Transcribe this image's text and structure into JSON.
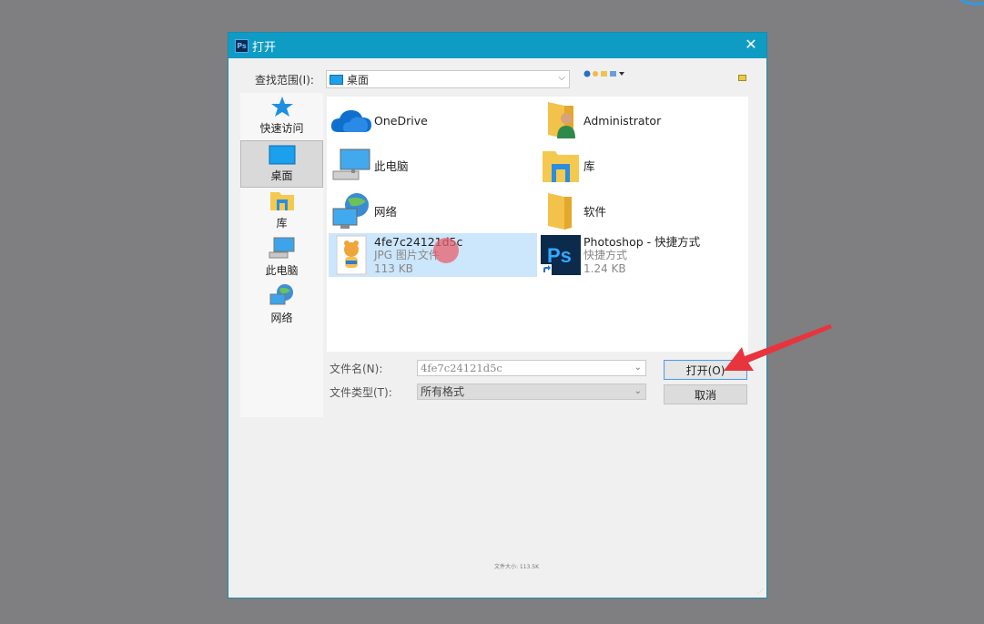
{
  "dialog": {
    "title": "打开",
    "app_icon_text": "Ps",
    "close_glyph": "✕"
  },
  "lookin": {
    "label": "查找范围(I):",
    "value": "桌面"
  },
  "places": [
    {
      "label": "快速访问",
      "icon": "star-icon"
    },
    {
      "label": "桌面",
      "icon": "desktop-icon",
      "selected": true
    },
    {
      "label": "库",
      "icon": "library-icon"
    },
    {
      "label": "此电脑",
      "icon": "computer-icon"
    },
    {
      "label": "网络",
      "icon": "network-icon"
    }
  ],
  "files": [
    {
      "name": "OneDrive",
      "icon": "cloud-icon"
    },
    {
      "name": "Administrator",
      "icon": "user-folder-icon"
    },
    {
      "name": "此电脑",
      "icon": "computer-icon"
    },
    {
      "name": "库",
      "icon": "library-icon"
    },
    {
      "name": "网络",
      "icon": "network-icon"
    },
    {
      "name": "软件",
      "icon": "folder-icon"
    },
    {
      "name": "4fe7c24121d5c",
      "type": "JPG 图片文件",
      "size": "113 KB",
      "icon": "image-file-icon",
      "selected": true
    },
    {
      "name": "Photoshop - 快捷方式",
      "type": "快捷方式",
      "size": "1.24 KB",
      "icon": "photoshop-icon"
    }
  ],
  "filename": {
    "label": "文件名(N):",
    "value": "4fe7c24121d5c"
  },
  "filetype": {
    "label": "文件类型(T):",
    "value": "所有格式"
  },
  "buttons": {
    "open": "打开(O)",
    "cancel": "取消"
  },
  "status": {
    "size_text": "文件大小: 113.5K"
  },
  "colors": {
    "titlebar": "#0f9cc4",
    "selection": "#cce6fb",
    "annotation_arrow": "#e8343c"
  }
}
